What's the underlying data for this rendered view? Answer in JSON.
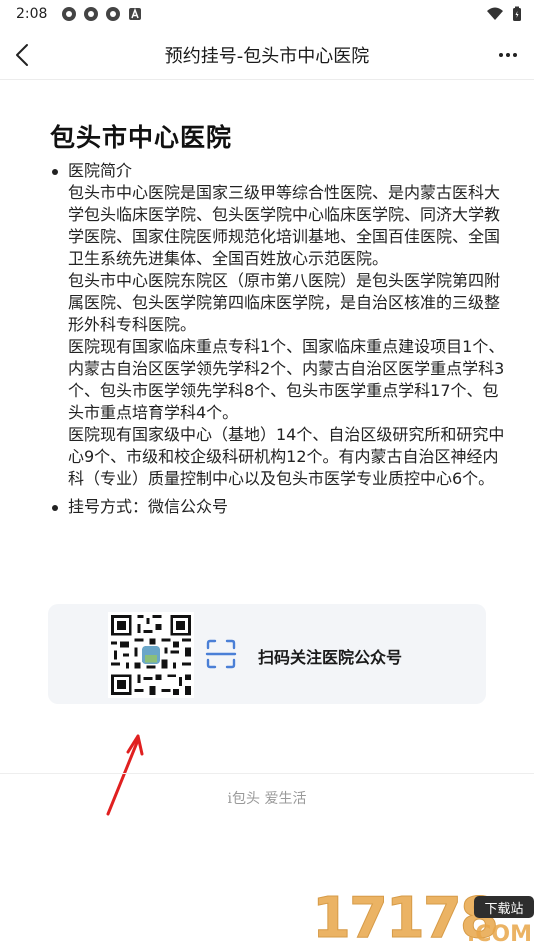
{
  "status_bar": {
    "time": "2:08"
  },
  "nav": {
    "title": "预约挂号-包头市中心医院"
  },
  "hospital": {
    "name": "包头市中心医院",
    "intro_heading": "医院简介",
    "intro_paragraphs": [
      "包头市中心医院是国家三级甲等综合性医院、是内蒙古医科大学包头临床医学院、包头医学院中心临床医学院、同济大学教学医院、国家住院医师规范化培训基地、全国百佳医院、全国卫生系统先进集体、全国百姓放心示范医院。",
      "包头市中心医院东院区（原市第八医院）是包头医学院第四附属医院、包头医学院第四临床医学院，是自治区核准的三级整形外科专科医院。",
      "医院现有国家临床重点专科1个、国家临床重点建设项目1个、内蒙古自治区医学领先学科2个、内蒙古自治区医学重点学科3个、包头市医学领先学科8个、包头市医学重点学科17个、包头市重点培育学科4个。",
      "医院现有国家级中心（基地）14个、自治区级研究所和研究中心9个、市级和校企级科研机构12个。有内蒙古自治区神经内科（专业）质量控制中心以及包头市医学专业质控中心6个。"
    ],
    "register_method": "挂号方式：微信公众号"
  },
  "qr_card": {
    "scan_label": "扫码关注医院公众号"
  },
  "footer": {
    "slogan": "i包头  爱生活"
  },
  "watermark": {
    "digits": "17178",
    "badge": "下载站",
    "suffix": ".COM"
  }
}
